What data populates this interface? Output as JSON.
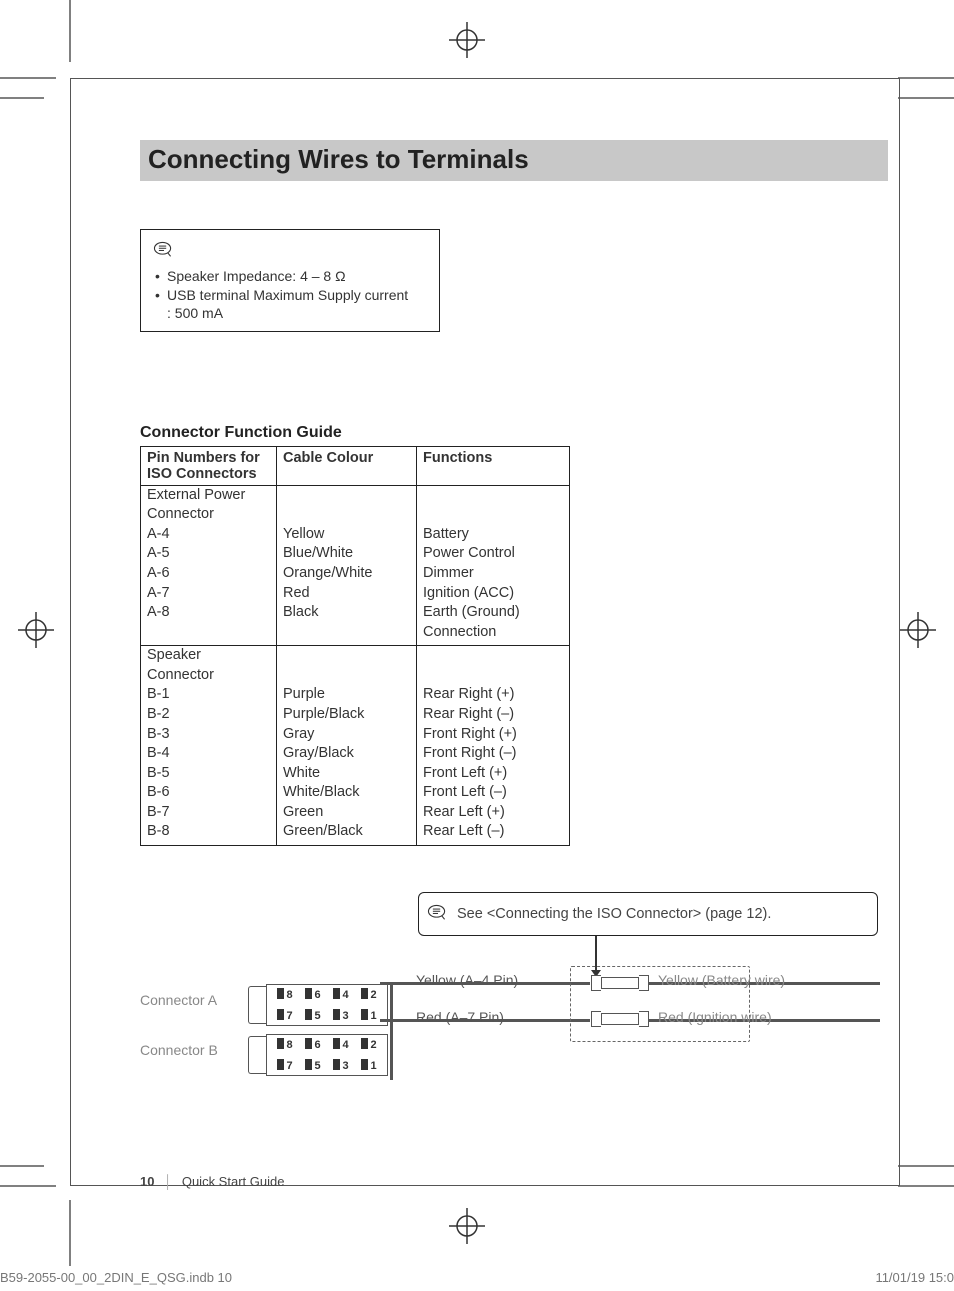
{
  "title": "Connecting Wires to Terminals",
  "notes": {
    "line1": "Speaker Impedance: 4 – 8 Ω",
    "line2": "USB terminal Maximum Supply current",
    "line2_sub": ": 500 mA"
  },
  "table": {
    "title": "Connector Function Guide",
    "headers": {
      "pin": "Pin Numbers for ISO Connectors",
      "colour": "Cable Colour",
      "func": "Functions"
    },
    "groups": [
      {
        "label": "External Power Connector",
        "rows": [
          {
            "pin": "A-4",
            "colour": "Yellow",
            "func": "Battery"
          },
          {
            "pin": "A-5",
            "colour": "Blue/White",
            "func": "Power Control"
          },
          {
            "pin": "A-6",
            "colour": "Orange/White",
            "func": "Dimmer"
          },
          {
            "pin": "A-7",
            "colour": "Red",
            "func": "Ignition (ACC)"
          },
          {
            "pin": "A-8",
            "colour": "Black",
            "func": "Earth (Ground) Connection"
          }
        ]
      },
      {
        "label": "Speaker Connector",
        "rows": [
          {
            "pin": "B-1",
            "colour": "Purple",
            "func": "Rear Right (+)"
          },
          {
            "pin": "B-2",
            "colour": "Purple/Black",
            "func": "Rear Right (–)"
          },
          {
            "pin": "B-3",
            "colour": "Gray",
            "func": "Front Right (+)"
          },
          {
            "pin": "B-4",
            "colour": "Gray/Black",
            "func": "Front Right (–)"
          },
          {
            "pin": "B-5",
            "colour": "White",
            "func": "Front Left (+)"
          },
          {
            "pin": "B-6",
            "colour": "White/Black",
            "func": "Front Left (–)"
          },
          {
            "pin": "B-7",
            "colour": "Green",
            "func": "Rear Left (+)"
          },
          {
            "pin": "B-8",
            "colour": "Green/Black",
            "func": "Rear Left (–)"
          }
        ]
      }
    ]
  },
  "diagram": {
    "callout": "See <Connecting the ISO Connector> (page 12).",
    "conn_a": "Connector A",
    "conn_b": "Connector B",
    "wire_yellow": "Yellow (A–4 Pin)",
    "wire_red": "Red (A–7 Pin)",
    "dest_yellow": "Yellow (Battery wire)",
    "dest_red": "Red (Ignition wire)",
    "pins_top_a": [
      "8",
      "6",
      "4",
      "2"
    ],
    "pins_bot_a": [
      "7",
      "5",
      "3",
      "1"
    ],
    "pins_top_b": [
      "8",
      "6",
      "4",
      "2"
    ],
    "pins_bot_b": [
      "7",
      "5",
      "3",
      "1"
    ]
  },
  "footer": {
    "page_num": "10",
    "guide": "Quick Start Guide",
    "file": "B59-2055-00_00_2DIN_E_QSG.indb   10",
    "date": "11/01/19   15:0"
  }
}
